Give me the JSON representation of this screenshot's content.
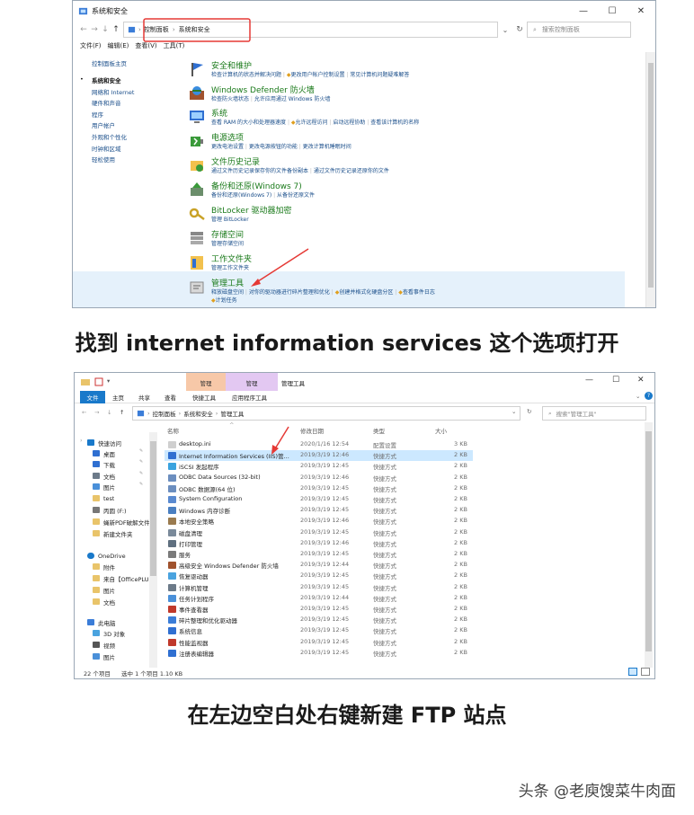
{
  "colors": {
    "link": "#1a4e8a",
    "heading_green": "#1a7a1a",
    "annotation_red": "#e53935",
    "selection": "#cce8ff",
    "file_tab": "#1979ca",
    "ctx_manage_tab": "#f7c8a8",
    "ctx_app_tab": "#e3c8f2"
  },
  "control_panel": {
    "window_title": "系统和安全",
    "window_buttons": [
      "—",
      "☐",
      "✕"
    ],
    "nav_buttons": [
      "←",
      "→",
      "↓",
      "↑"
    ],
    "breadcrumb": [
      "控制面板",
      "系统和安全"
    ],
    "search_placeholder": "搜索控制面板",
    "menu": [
      "文件(F)",
      "编辑(E)",
      "查看(V)",
      "工具(T)"
    ],
    "left_nav": [
      {
        "label": "控制面板主页",
        "current": false
      },
      {
        "label": "系统和安全",
        "current": true
      },
      {
        "label": "网络和 Internet",
        "current": false
      },
      {
        "label": "硬件和声音",
        "current": false
      },
      {
        "label": "程序",
        "current": false
      },
      {
        "label": "用户帐户",
        "current": false
      },
      {
        "label": "外观和个性化",
        "current": false
      },
      {
        "label": "时钟和区域",
        "current": false
      },
      {
        "label": "轻松使用",
        "current": false
      }
    ],
    "sections": [
      {
        "title": "安全和维护",
        "icon": "flag-icon",
        "links": [
          "检查计算机的状态并解决问题",
          "更改用户帐户控制设置",
          "常见计算机问题疑难解答"
        ]
      },
      {
        "title": "Windows Defender 防火墙",
        "icon": "firewall-icon",
        "links": [
          "检查防火墙状态",
          "允许应用通过 Windows 防火墙"
        ]
      },
      {
        "title": "系统",
        "icon": "computer-icon",
        "links": [
          "查看 RAM 的大小和处理器速度",
          "允许远程访问",
          "启动远程协助",
          "查看该计算机的名称"
        ]
      },
      {
        "title": "电源选项",
        "icon": "power-icon",
        "links": [
          "更改电池设置",
          "更改电源按钮的功能",
          "更改计算机睡眠时间"
        ]
      },
      {
        "title": "文件历史记录",
        "icon": "file-history-icon",
        "links": [
          "通过文件历史记录保存你的文件备份副本",
          "通过文件历史记录还原你的文件"
        ]
      },
      {
        "title": "备份和还原(Windows 7)",
        "icon": "backup-icon",
        "links": [
          "备份和还原(Windows 7)",
          "从备份还原文件"
        ]
      },
      {
        "title": "BitLocker 驱动器加密",
        "icon": "bitlocker-icon",
        "links": [
          "管理 BitLocker"
        ]
      },
      {
        "title": "存储空间",
        "icon": "storage-icon",
        "links": [
          "管理存储空间"
        ]
      },
      {
        "title": "工作文件夹",
        "icon": "work-folders-icon",
        "links": [
          "管理工作文件夹"
        ]
      },
      {
        "title": "管理工具",
        "icon": "admin-tools-icon",
        "links": [
          "释放磁盘空间",
          "对你的驱动器进行碎片整理和优化",
          "创建并格式化硬盘分区",
          "查看事件日志",
          "计划任务"
        ]
      }
    ]
  },
  "caption1": "找到 internet information services 这个选项打开",
  "explorer": {
    "quick_access_toolbar": "▾",
    "context_tabs": [
      "管理",
      "管理"
    ],
    "window_title": "管理工具",
    "window_buttons": [
      "—",
      "☐",
      "✕"
    ],
    "ribbon_tabs": [
      "文件",
      "主页",
      "共享",
      "查看",
      "快捷工具",
      "应用程序工具"
    ],
    "nav_buttons": [
      "←",
      "→",
      "↓",
      "↑"
    ],
    "breadcrumb": [
      "控制面板",
      "系统和安全",
      "管理工具"
    ],
    "search_placeholder": "搜索\"管理工具\"",
    "columns": [
      "名称",
      "修改日期",
      "类型",
      "大小"
    ],
    "nav_tree": [
      {
        "label": "快速访问",
        "icon": "star-icon",
        "pinned": false
      },
      {
        "label": "桌面",
        "icon": "desktop-icon",
        "pinned": true
      },
      {
        "label": "下载",
        "icon": "download-icon",
        "pinned": true
      },
      {
        "label": "文档",
        "icon": "documents-icon",
        "pinned": true
      },
      {
        "label": "图片",
        "icon": "pictures-icon",
        "pinned": true
      },
      {
        "label": "test",
        "icon": "folder-icon",
        "pinned": false
      },
      {
        "label": "丙圆 (F:)",
        "icon": "drive-icon",
        "pinned": false
      },
      {
        "label": "蝇新PDF破解文件",
        "icon": "folder-icon",
        "pinned": false
      },
      {
        "label": "新建文件夹",
        "icon": "folder-icon",
        "pinned": false
      },
      {
        "label": "OneDrive",
        "icon": "cloud-icon",
        "pinned": false
      },
      {
        "label": "附件",
        "icon": "folder-icon",
        "pinned": false
      },
      {
        "label": "来自【OfficePLU",
        "icon": "folder-icon",
        "pinned": false
      },
      {
        "label": "图片",
        "icon": "folder-icon",
        "pinned": false
      },
      {
        "label": "文档",
        "icon": "folder-icon",
        "pinned": false
      },
      {
        "label": "此电脑",
        "icon": "pc-icon",
        "pinned": false
      },
      {
        "label": "3D 对象",
        "icon": "3d-icon",
        "pinned": false
      },
      {
        "label": "视频",
        "icon": "video-icon",
        "pinned": false
      },
      {
        "label": "图片",
        "icon": "pictures-icon",
        "pinned": false
      }
    ],
    "files": [
      {
        "name": "desktop.ini",
        "date": "2020/1/16 12:54",
        "type": "配置设置",
        "size": "3 KB",
        "selected": false
      },
      {
        "name": "Internet Information Services (IIS)管...",
        "date": "2019/3/19 12:46",
        "type": "快捷方式",
        "size": "2 KB",
        "selected": true
      },
      {
        "name": "iSCSI 发起程序",
        "date": "2019/3/19 12:45",
        "type": "快捷方式",
        "size": "2 KB",
        "selected": false
      },
      {
        "name": "ODBC Data Sources (32-bit)",
        "date": "2019/3/19 12:46",
        "type": "快捷方式",
        "size": "2 KB",
        "selected": false
      },
      {
        "name": "ODBC 数据源(64 位)",
        "date": "2019/3/19 12:45",
        "type": "快捷方式",
        "size": "2 KB",
        "selected": false
      },
      {
        "name": "System Configuration",
        "date": "2019/3/19 12:45",
        "type": "快捷方式",
        "size": "2 KB",
        "selected": false
      },
      {
        "name": "Windows 内存诊断",
        "date": "2019/3/19 12:45",
        "type": "快捷方式",
        "size": "2 KB",
        "selected": false
      },
      {
        "name": "本地安全策略",
        "date": "2019/3/19 12:46",
        "type": "快捷方式",
        "size": "2 KB",
        "selected": false
      },
      {
        "name": "磁盘清理",
        "date": "2019/3/19 12:45",
        "type": "快捷方式",
        "size": "2 KB",
        "selected": false
      },
      {
        "name": "打印管理",
        "date": "2019/3/19 12:46",
        "type": "快捷方式",
        "size": "2 KB",
        "selected": false
      },
      {
        "name": "服务",
        "date": "2019/3/19 12:45",
        "type": "快捷方式",
        "size": "2 KB",
        "selected": false
      },
      {
        "name": "高级安全 Windows Defender 防火墙",
        "date": "2019/3/19 12:44",
        "type": "快捷方式",
        "size": "2 KB",
        "selected": false
      },
      {
        "name": "恢复驱动器",
        "date": "2019/3/19 12:45",
        "type": "快捷方式",
        "size": "2 KB",
        "selected": false
      },
      {
        "name": "计算机管理",
        "date": "2019/3/19 12:45",
        "type": "快捷方式",
        "size": "2 KB",
        "selected": false
      },
      {
        "name": "任务计划程序",
        "date": "2019/3/19 12:44",
        "type": "快捷方式",
        "size": "2 KB",
        "selected": false
      },
      {
        "name": "事件查看器",
        "date": "2019/3/19 12:45",
        "type": "快捷方式",
        "size": "2 KB",
        "selected": false
      },
      {
        "name": "碎片整理和优化驱动器",
        "date": "2019/3/19 12:45",
        "type": "快捷方式",
        "size": "2 KB",
        "selected": false
      },
      {
        "name": "系统信息",
        "date": "2019/3/19 12:45",
        "type": "快捷方式",
        "size": "2 KB",
        "selected": false
      },
      {
        "name": "性能监视器",
        "date": "2019/3/19 12:45",
        "type": "快捷方式",
        "size": "2 KB",
        "selected": false
      },
      {
        "name": "注册表编辑器",
        "date": "2019/3/19 12:45",
        "type": "快捷方式",
        "size": "2 KB",
        "selected": false
      }
    ],
    "status_count": "22 个项目",
    "status_selected": "选中 1 个项目  1.10 KB",
    "view_toggles": [
      "details-view-icon",
      "tiles-view-icon"
    ]
  },
  "caption2": "在左边空白处右键新建 FTP 站点",
  "watermark": "头条 @老庾馊菜牛肉面"
}
